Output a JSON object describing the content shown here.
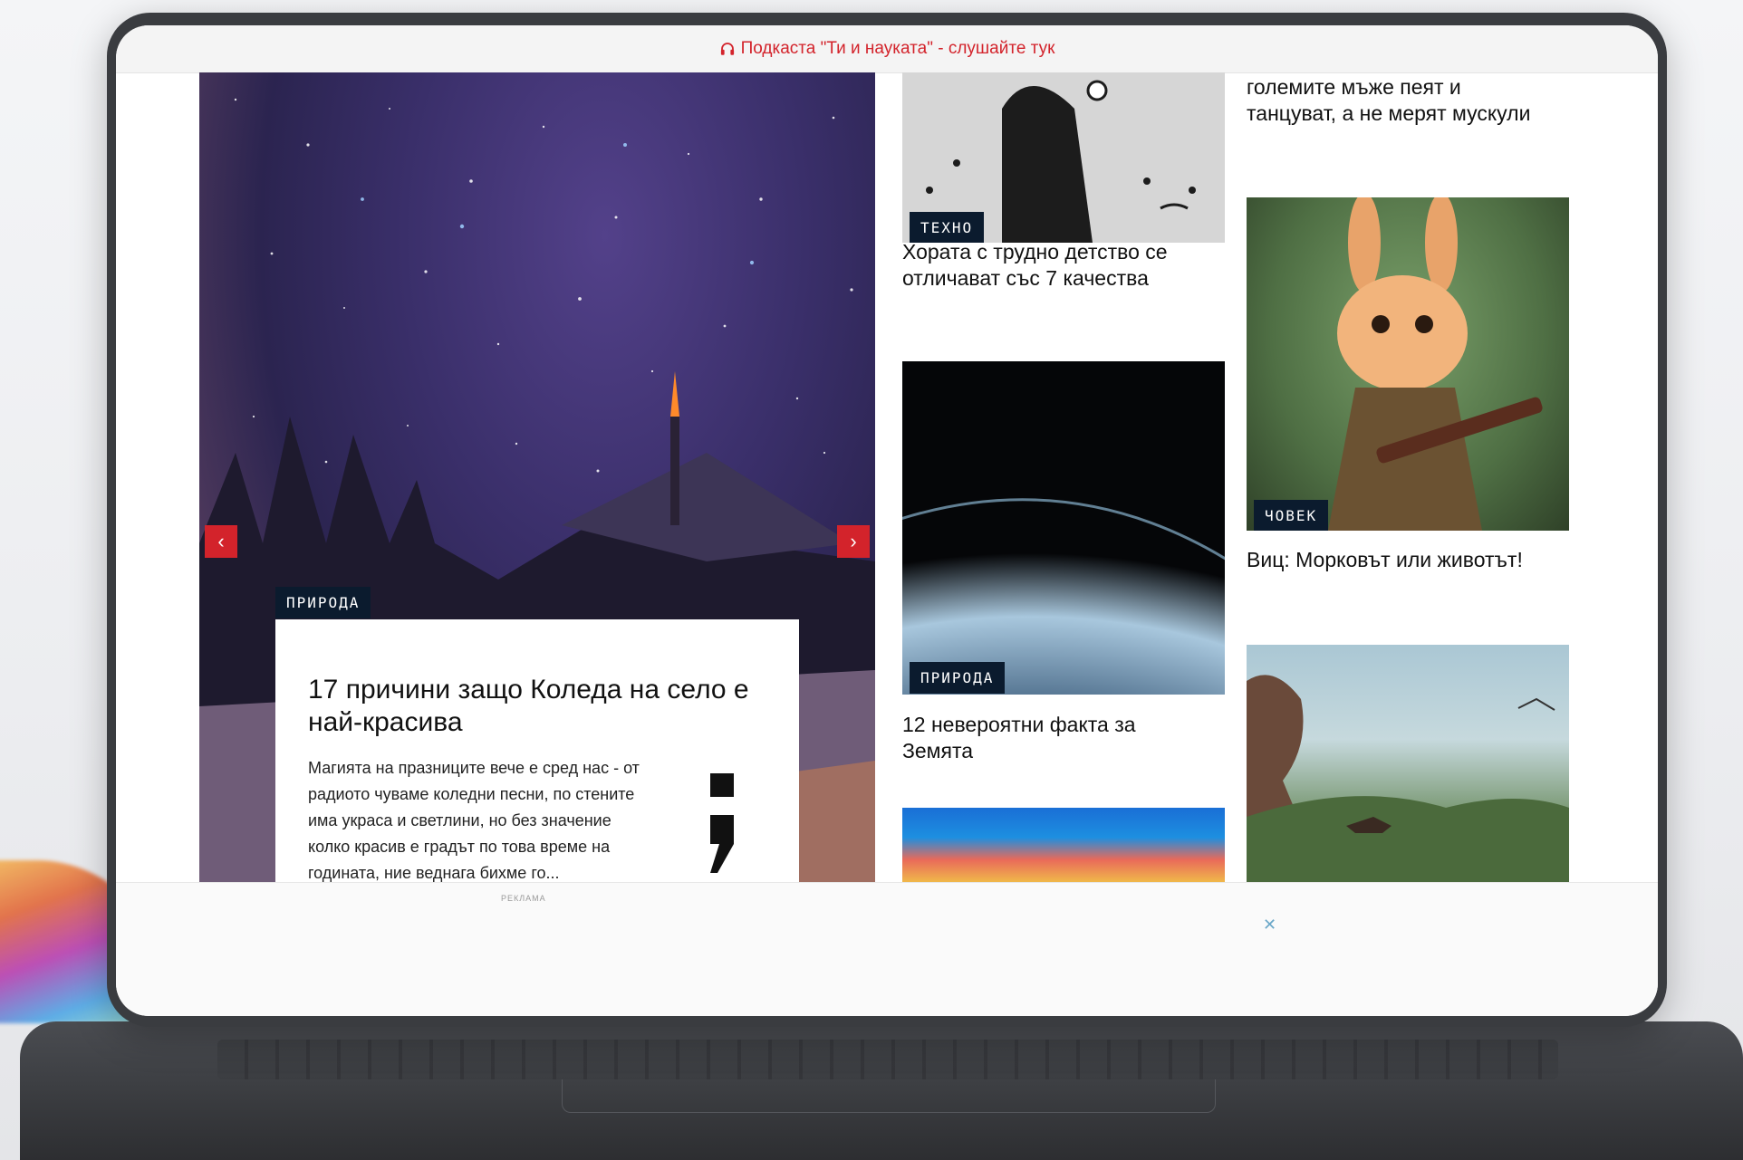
{
  "topbar": {
    "podcast_link": "Подкаста \"Ти и науката\" - слушайте тук"
  },
  "hero": {
    "category": "ПРИРОДА",
    "title": "17 причини защо Коледа на село е най-красива",
    "excerpt": "Магията на празниците вече е сред нас - от радиото чуваме коледни песни, по стените има украса и светлини, но без значение колко красив е градът по това време на годината, ние веднага бихме го..."
  },
  "col_middle": {
    "article1": {
      "category": "ТЕХНО",
      "title": "Хората с трудно детство се отличават със 7 качества"
    },
    "article2": {
      "category": "ПРИРОДА",
      "title": "12 невероятни факта за Земята"
    }
  },
  "col_right": {
    "article0": {
      "title": "големите мъже пеят и танцуват, а не мерят мускули"
    },
    "article1": {
      "category": "ЧОВЕК",
      "title": "Виц: Морковът или животът!"
    }
  },
  "ad": {
    "label": "РЕКЛАМА",
    "close": "✕"
  },
  "hero_nav": {
    "prev": "‹",
    "next": "›"
  },
  "colors": {
    "accent": "#d3232b",
    "badge_bg": "#0b1b2e"
  }
}
